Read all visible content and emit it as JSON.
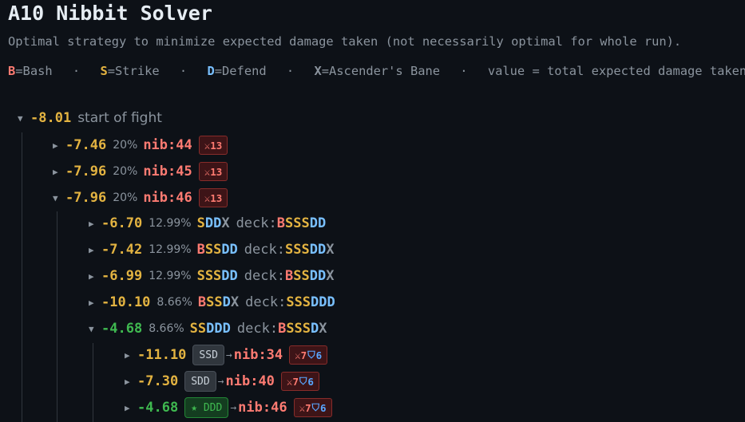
{
  "header": {
    "title": "A10 Nibbit Solver",
    "subtitle": "Optimal strategy to minimize expected damage taken (not necessarily optimal for whole run)."
  },
  "legend": {
    "bash": {
      "key": "B",
      "text": "=Bash"
    },
    "strike": {
      "key": "S",
      "text": "=Strike"
    },
    "defend": {
      "key": "D",
      "text": "=Defend"
    },
    "bane": {
      "key": "X",
      "text": "=Ascender's Bane"
    },
    "value_note": "value = total expected damage taken",
    "sep": "·"
  },
  "icons": {
    "expanded": "expanded-triangle-icon",
    "collapsed": "collapsed-triangle-icon",
    "sword": "crossed-swords-icon",
    "shield": "shield-icon",
    "star": "star-icon",
    "arrow": "arrow-right-icon"
  },
  "colors": {
    "bash": "#ff7b72",
    "strike": "#e3b341",
    "defend": "#79c0ff",
    "bane": "#8b949e",
    "best": "#3fb950",
    "background": "#0d1117"
  },
  "tree": {
    "root": {
      "toggle": "▼",
      "value": "-8.01",
      "label": "start of fight"
    },
    "nodes": [
      {
        "toggle": "▶",
        "value": "-7.46",
        "pct": "20%",
        "nib": "nib:44",
        "attack": "⚔13"
      },
      {
        "toggle": "▶",
        "value": "-7.96",
        "pct": "20%",
        "nib": "nib:45",
        "attack": "⚔13"
      },
      {
        "toggle": "▼",
        "value": "-7.96",
        "pct": "20%",
        "nib": "nib:46",
        "attack": "⚔13"
      }
    ],
    "hands": [
      {
        "toggle": "▶",
        "value": "-6.70",
        "pct": "12.99%",
        "hand": [
          [
            "S",
            "S"
          ],
          [
            "D",
            "DD"
          ],
          [
            "X",
            "X"
          ]
        ],
        "deck_label": "deck:",
        "deck": [
          [
            "B",
            "B"
          ],
          [
            "S",
            "SSS"
          ],
          [
            "D",
            "DD"
          ]
        ]
      },
      {
        "toggle": "▶",
        "value": "-7.42",
        "pct": "12.99%",
        "hand": [
          [
            "B",
            "B"
          ],
          [
            "S",
            "SS"
          ],
          [
            "D",
            "DD"
          ]
        ],
        "deck_label": "deck:",
        "deck": [
          [
            "S",
            "SSS"
          ],
          [
            "D",
            "DD"
          ],
          [
            "X",
            "X"
          ]
        ]
      },
      {
        "toggle": "▶",
        "value": "-6.99",
        "pct": "12.99%",
        "hand": [
          [
            "S",
            "SSS"
          ],
          [
            "D",
            "DD"
          ]
        ],
        "deck_label": "deck:",
        "deck": [
          [
            "B",
            "B"
          ],
          [
            "S",
            "SS"
          ],
          [
            "D",
            "DD"
          ],
          [
            "X",
            "X"
          ]
        ]
      },
      {
        "toggle": "▶",
        "value": "-10.10",
        "pct": "8.66%",
        "hand": [
          [
            "B",
            "B"
          ],
          [
            "S",
            "SS"
          ],
          [
            "D",
            "D"
          ],
          [
            "X",
            "X"
          ]
        ],
        "deck_label": "deck:",
        "deck": [
          [
            "S",
            "SSS"
          ],
          [
            "D",
            "DDD"
          ]
        ]
      },
      {
        "toggle": "▼",
        "value": "-4.68",
        "pct": "8.66%",
        "hand": [
          [
            "S",
            "SS"
          ],
          [
            "D",
            "DDD"
          ]
        ],
        "deck_label": "deck:",
        "deck": [
          [
            "B",
            "B"
          ],
          [
            "S",
            "SSS"
          ],
          [
            "D",
            "D"
          ],
          [
            "X",
            "X"
          ]
        ],
        "good": true
      }
    ],
    "plays": [
      {
        "toggle": "▶",
        "value": "-11.10",
        "play": "SSD",
        "arrow": "→",
        "nib": "nib:34",
        "attack": "⚔7",
        "block": "6"
      },
      {
        "toggle": "▶",
        "value": "-7.30",
        "play": "SDD",
        "arrow": "→",
        "nib": "nib:40",
        "attack": "⚔7",
        "block": "6"
      },
      {
        "toggle": "▶",
        "value": "-4.68",
        "play": "★ DDD",
        "arrow": "→",
        "nib": "nib:46",
        "attack": "⚔7",
        "block": "6",
        "best": true
      }
    ]
  }
}
